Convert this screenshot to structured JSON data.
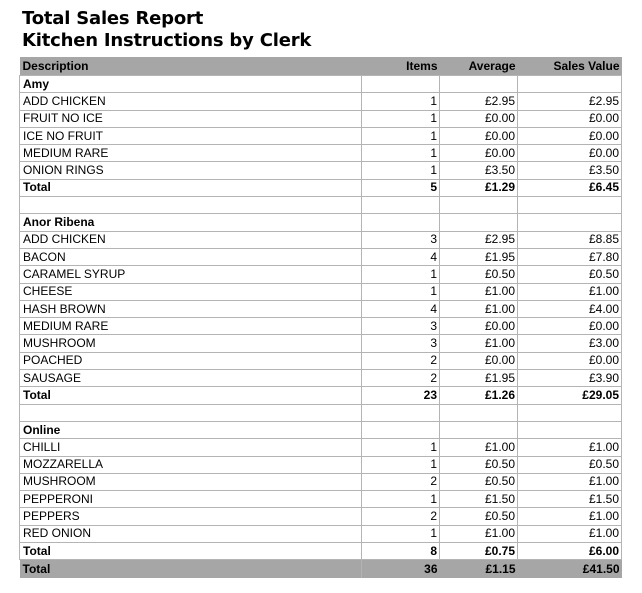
{
  "report": {
    "title": "Total Sales Report",
    "subtitle": "Kitchen Instructions by Clerk"
  },
  "columns": {
    "description": "Description",
    "items": "Items",
    "average": "Average",
    "sales_value": "Sales Value"
  },
  "groups": [
    {
      "name": "Amy",
      "rows": [
        {
          "description": "ADD CHICKEN",
          "items": "1",
          "average": "£2.95",
          "sales_value": "£2.95"
        },
        {
          "description": "FRUIT NO ICE",
          "items": "1",
          "average": "£0.00",
          "sales_value": "£0.00"
        },
        {
          "description": "ICE NO FRUIT",
          "items": "1",
          "average": "£0.00",
          "sales_value": "£0.00"
        },
        {
          "description": "MEDIUM RARE",
          "items": "1",
          "average": "£0.00",
          "sales_value": "£0.00"
        },
        {
          "description": "ONION RINGS",
          "items": "1",
          "average": "£3.50",
          "sales_value": "£3.50"
        }
      ],
      "total": {
        "label": "Total",
        "items": "5",
        "average": "£1.29",
        "sales_value": "£6.45"
      }
    },
    {
      "name": "Anor Ribena",
      "rows": [
        {
          "description": "ADD CHICKEN",
          "items": "3",
          "average": "£2.95",
          "sales_value": "£8.85"
        },
        {
          "description": "BACON",
          "items": "4",
          "average": "£1.95",
          "sales_value": "£7.80"
        },
        {
          "description": "CARAMEL SYRUP",
          "items": "1",
          "average": "£0.50",
          "sales_value": "£0.50"
        },
        {
          "description": "CHEESE",
          "items": "1",
          "average": "£1.00",
          "sales_value": "£1.00"
        },
        {
          "description": "HASH BROWN",
          "items": "4",
          "average": "£1.00",
          "sales_value": "£4.00"
        },
        {
          "description": "MEDIUM RARE",
          "items": "3",
          "average": "£0.00",
          "sales_value": "£0.00"
        },
        {
          "description": "MUSHROOM",
          "items": "3",
          "average": "£1.00",
          "sales_value": "£3.00"
        },
        {
          "description": "POACHED",
          "items": "2",
          "average": "£0.00",
          "sales_value": "£0.00"
        },
        {
          "description": "SAUSAGE",
          "items": "2",
          "average": "£1.95",
          "sales_value": "£3.90"
        }
      ],
      "total": {
        "label": "Total",
        "items": "23",
        "average": "£1.26",
        "sales_value": "£29.05"
      }
    },
    {
      "name": "Online",
      "rows": [
        {
          "description": "CHILLI",
          "items": "1",
          "average": "£1.00",
          "sales_value": "£1.00"
        },
        {
          "description": "MOZZARELLA",
          "items": "1",
          "average": "£0.50",
          "sales_value": "£0.50"
        },
        {
          "description": "MUSHROOM",
          "items": "2",
          "average": "£0.50",
          "sales_value": "£1.00"
        },
        {
          "description": "PEPPERONI",
          "items": "1",
          "average": "£1.50",
          "sales_value": "£1.50"
        },
        {
          "description": "PEPPERS",
          "items": "2",
          "average": "£0.50",
          "sales_value": "£1.00"
        },
        {
          "description": "RED ONION",
          "items": "1",
          "average": "£1.00",
          "sales_value": "£1.00"
        }
      ],
      "total": {
        "label": "Total",
        "items": "8",
        "average": "£0.75",
        "sales_value": "£6.00"
      }
    }
  ],
  "grand_total": {
    "label": "Total",
    "items": "36",
    "average": "£1.15",
    "sales_value": "£41.50"
  }
}
